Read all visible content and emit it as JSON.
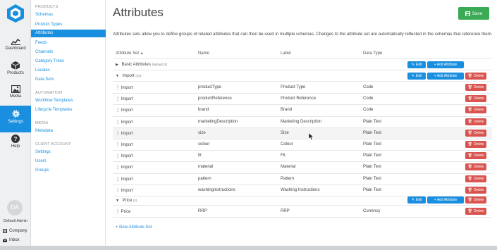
{
  "rail": {
    "items": [
      {
        "label": "Dashboard",
        "icon": "dashboard-icon"
      },
      {
        "label": "Products",
        "icon": "products-icon"
      },
      {
        "label": "Media",
        "icon": "media-icon"
      },
      {
        "label": "Settings",
        "icon": "settings-icon"
      },
      {
        "label": "Help",
        "icon": "help-icon"
      }
    ],
    "avatar_initials": "DA",
    "admin_name": "Default Admin",
    "company_label": "Company",
    "inbox_label": "Inbox"
  },
  "subnav": {
    "products_heading": "PRODUCTS",
    "products_items": [
      "Schemas",
      "Product Types",
      "Attributes",
      "Feeds",
      "Channels",
      "Category Trees",
      "Locales",
      "Data Sets"
    ],
    "automation_heading": "AUTOMATION",
    "automation_items": [
      "Workflow Templates",
      "Lifecycle Templates"
    ],
    "media_heading": "MEDIA",
    "media_items": [
      "Metadata"
    ],
    "client_heading": "CLIENT ACCOUNT",
    "client_items": [
      "Settings",
      "Users",
      "Groups"
    ]
  },
  "page": {
    "title": "Attributes",
    "save_label": "Save",
    "description": "Attributes sets allow you to define groups of related attributes that can then be used in multiple schemas. Changes to the attribute set are automatically reflected in the schemas that reference them.",
    "new_set_label": "+ New Attribute Set"
  },
  "table": {
    "headers": {
      "set": "Attribute Set",
      "name": "Name",
      "label": "Label",
      "type": "Data Type"
    },
    "edit_label": "Edit",
    "add_label": "+ Add Attribute",
    "delete_label": "Delete",
    "basic": {
      "name": "Basic Attributes",
      "count": "(default12)"
    },
    "import": {
      "name": "Import",
      "count": "(10)"
    },
    "import_rows": [
      {
        "set": "Import",
        "name": "productType",
        "label": "Product Type",
        "type": "Code"
      },
      {
        "set": "Import",
        "name": "productReference",
        "label": "Product Reference",
        "type": "Code"
      },
      {
        "set": "Import",
        "name": "brand",
        "label": "Brand",
        "type": "Code"
      },
      {
        "set": "Import",
        "name": "marketingDescription",
        "label": "Marketing Description",
        "type": "Plain Text"
      },
      {
        "set": "Import",
        "name": "size",
        "label": "Size",
        "type": "Plain Text"
      },
      {
        "set": "Import",
        "name": "colour",
        "label": "Colour",
        "type": "Plain Text"
      },
      {
        "set": "Import",
        "name": "fit",
        "label": "Fit",
        "type": "Plain Text"
      },
      {
        "set": "Import",
        "name": "material",
        "label": "Material",
        "type": "Plain Text"
      },
      {
        "set": "Import",
        "name": "pattern",
        "label": "Pattern",
        "type": "Plain Text"
      },
      {
        "set": "Import",
        "name": "washingInstructions",
        "label": "Washing Instructions",
        "type": "Plain Text"
      }
    ],
    "price": {
      "name": "Price",
      "count": "(1)"
    },
    "price_rows": [
      {
        "set": "Price",
        "name": "RRP",
        "label": "RRP",
        "type": "Currency"
      }
    ]
  },
  "colors": {
    "accent": "#1a8fe0",
    "save": "#3aaa55",
    "delete": "#d9534f"
  }
}
